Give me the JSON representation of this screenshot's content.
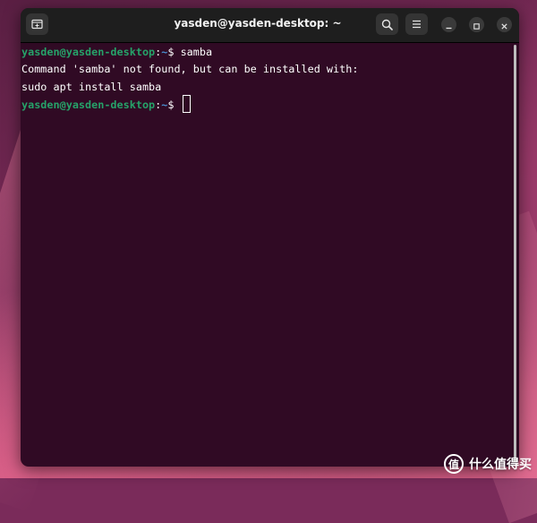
{
  "window": {
    "title": "yasden@yasden-desktop: ~"
  },
  "icons": {
    "new_tab": "new-tab-icon",
    "search": "search-icon",
    "menu": "hamburger-menu-icon",
    "minimize": "minimize-icon",
    "maximize": "maximize-icon",
    "close": "close-icon"
  },
  "terminal": {
    "lines": [
      {
        "user": "yasden@yasden-desktop",
        "sep": ":",
        "path": "~",
        "rest": "$ samba"
      },
      {
        "text": "Command 'samba' not found, but can be installed with:"
      },
      {
        "text": "sudo apt install samba"
      },
      {
        "user": "yasden@yasden-desktop",
        "sep": ":",
        "path": "~",
        "rest": "$ "
      }
    ]
  },
  "watermark": {
    "logo": "值",
    "text": "什么值得买"
  },
  "colors": {
    "terminal_bg": "#300a24",
    "prompt_user": "#26a269",
    "prompt_path": "#4a8fd1",
    "titlebar_bg": "#1e1e1e"
  }
}
